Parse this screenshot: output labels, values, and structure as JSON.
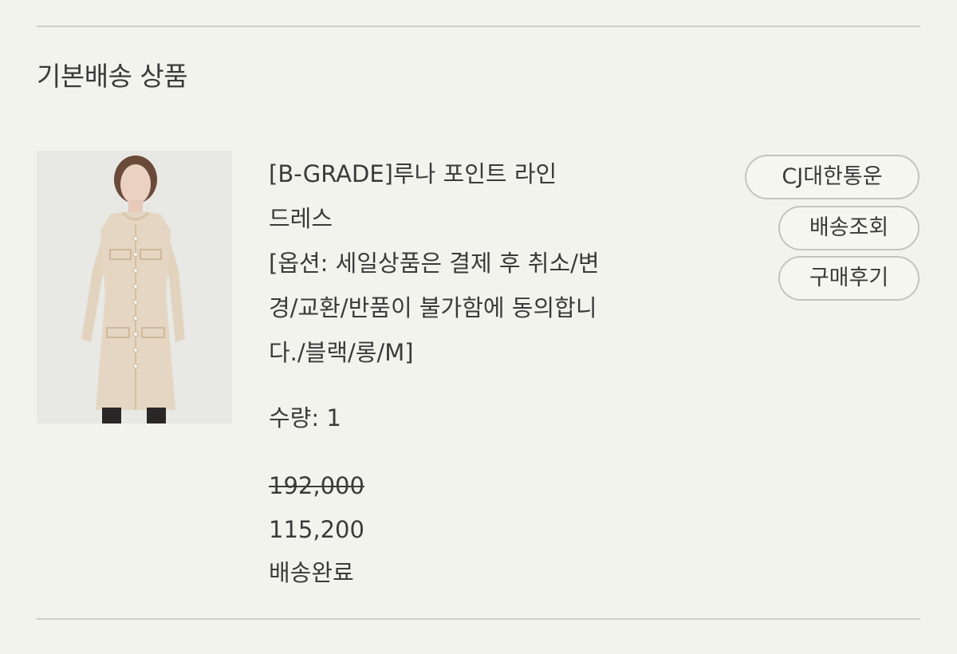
{
  "section": {
    "title": "기본배송 상품"
  },
  "product": {
    "name_lines": [
      "[B-GRADE]루나 포인트 라인",
      "드레스",
      "[옵션: 세일상품은 결제 후 취소/변",
      "경/교환/반품이 불가함에 동의합니",
      "다./블랙/롱/M]"
    ],
    "quantity_text": "수량: 1",
    "original_price": "192,000",
    "sale_price": "115,200",
    "status": "배송완료"
  },
  "actions": {
    "courier_label": "CJ대한통운",
    "track_label": "배송조회",
    "review_label": "구매후기"
  },
  "colors": {
    "background": "#f3f3ee",
    "text": "#3a3a3a",
    "divider": "#cfcfca",
    "pill_border": "#c4c4bf"
  }
}
